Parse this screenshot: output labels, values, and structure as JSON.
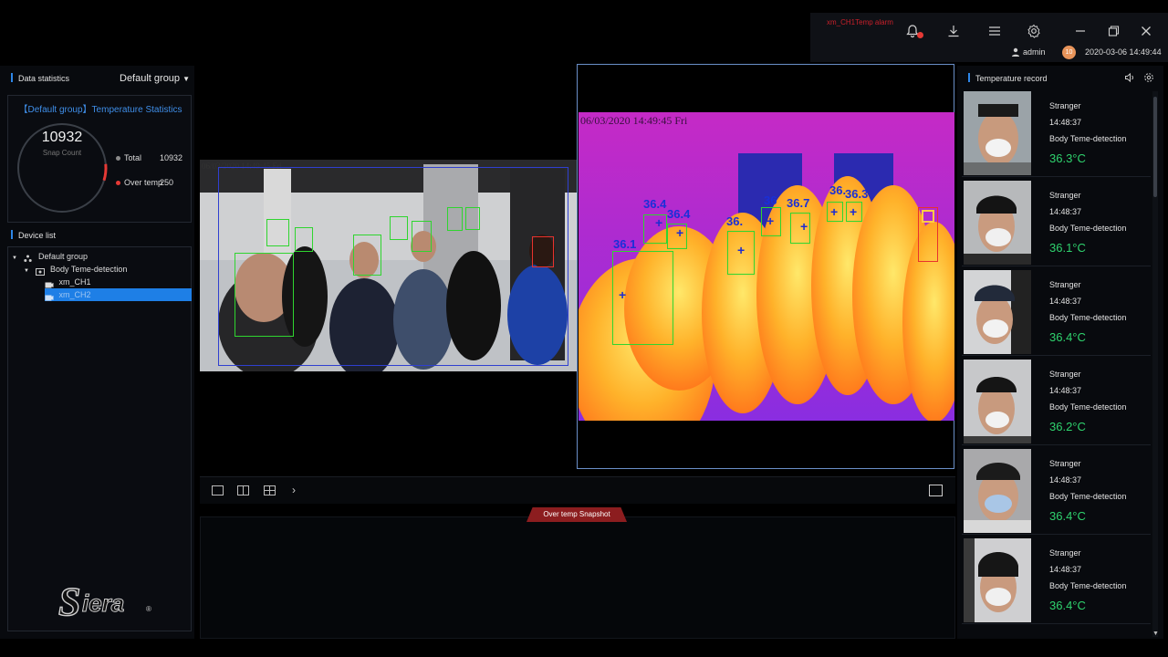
{
  "topbar": {
    "alarm_text": "xm_CH1Temp alarm",
    "user": "admin",
    "avatar_text": "10",
    "datetime": "2020-03-06 14:49:44"
  },
  "left": {
    "data_statistics": "Data statistics",
    "group_select": "Default group",
    "stats_title": "【Default group】Temperature Statistics",
    "snap_count": "10932",
    "snap_count_label": "Snap Count",
    "total_label": "Total",
    "total_value": "10932",
    "over_label": "Over temp",
    "over_value": "250",
    "over_fraction": 0.023,
    "device_list": "Device list",
    "tree": {
      "group": "Default group",
      "device": "Body Teme-detection",
      "ch1": "xm_CH1",
      "ch2": "xm_CH2"
    },
    "logo_text": "Siera"
  },
  "center": {
    "left_osd": "06/03/2020 14:49:45 Fri",
    "right_osd": "06/03/2020 14:49:45 Fri",
    "temps": [
      "36.4",
      "36.4",
      "36.1",
      "36.",
      "36",
      "36.7",
      "36.",
      "36.3"
    ]
  },
  "snapshot": {
    "tab": "Over temp Snapshot"
  },
  "right": {
    "title": "Temperature record",
    "records": [
      {
        "name": "Stranger",
        "time": "14:48:37",
        "type": "Body Teme-detection",
        "temp": "36.3°C"
      },
      {
        "name": "Stranger",
        "time": "14:48:37",
        "type": "Body Teme-detection",
        "temp": "36.1°C"
      },
      {
        "name": "Stranger",
        "time": "14:48:37",
        "type": "Body Teme-detection",
        "temp": "36.4°C"
      },
      {
        "name": "Stranger",
        "time": "14:48:37",
        "type": "Body Teme-detection",
        "temp": "36.2°C"
      },
      {
        "name": "Stranger",
        "time": "14:48:37",
        "type": "Body Teme-detection",
        "temp": "36.4°C"
      },
      {
        "name": "Stranger",
        "time": "14:48:37",
        "type": "Body Teme-detection",
        "temp": "36.4°C"
      }
    ]
  },
  "colors": {
    "accent_blue": "#2d86e8",
    "temp_green": "#2fd36e",
    "alarm_red": "#c8202a"
  }
}
